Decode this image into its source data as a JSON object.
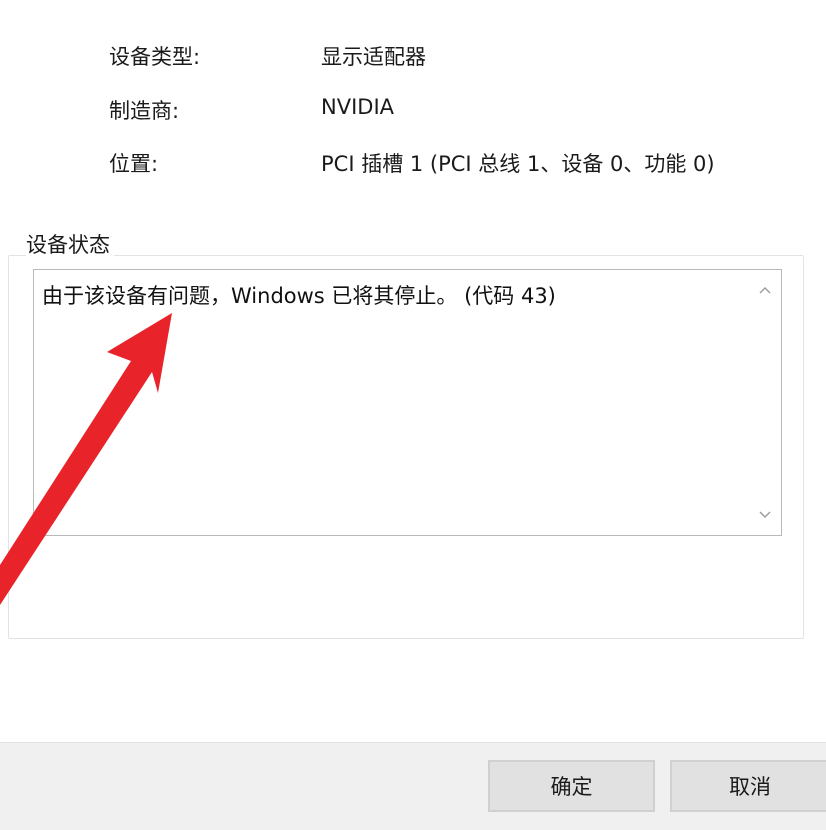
{
  "properties": [
    {
      "label": "设备类型:",
      "value": "显示适配器"
    },
    {
      "label": "制造商:",
      "value": "NVIDIA"
    },
    {
      "label": "位置:",
      "value": "PCI 插槽 1 (PCI 总线 1、设备 0、功能 0)"
    }
  ],
  "device_status": {
    "legend": "设备状态",
    "message": "由于该设备有问题，Windows 已将其停止。 (代码 43)"
  },
  "icons": {
    "scroll_up": "chevron-up-icon",
    "scroll_down": "chevron-down-icon",
    "annotation": "red-arrow-icon"
  },
  "buttons": {
    "ok": "确定",
    "cancel": "取消"
  },
  "colors": {
    "annotation_arrow": "#e8242a",
    "footer_bg": "#f0f0f0",
    "button_bg": "#e1e1e1"
  }
}
